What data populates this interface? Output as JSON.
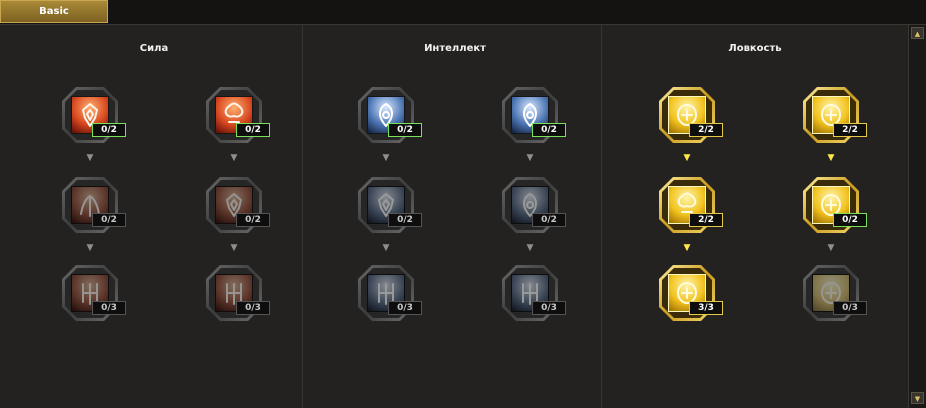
{
  "tabs": [
    {
      "label": "Basic",
      "selected": true
    }
  ],
  "columns": [
    {
      "title": "Сила",
      "theme": "fire",
      "rows": [
        [
          {
            "icon": "demon-crest-icon",
            "points": "0/2",
            "state": "available"
          },
          {
            "icon": "flame-knot-icon",
            "points": "0/2",
            "state": "available"
          }
        ],
        [
          {
            "icon": "claw-rune-icon",
            "points": "0/2",
            "state": "locked"
          },
          {
            "icon": "blade-crest-icon",
            "points": "0/2",
            "state": "locked"
          }
        ],
        [
          {
            "icon": "horn-glyph-icon",
            "points": "0/3",
            "state": "locked"
          },
          {
            "icon": "wing-glyph-icon",
            "points": "0/3",
            "state": "locked"
          }
        ]
      ]
    },
    {
      "title": "Интеллект",
      "theme": "arcane",
      "rows": [
        [
          {
            "icon": "ice-sigil-icon",
            "points": "0/2",
            "state": "available"
          },
          {
            "icon": "eye-sigil-icon",
            "points": "0/2",
            "state": "available"
          }
        ],
        [
          {
            "icon": "spiral-rune-icon",
            "points": "0/2",
            "state": "locked"
          },
          {
            "icon": "hood-sigil-icon",
            "points": "0/2",
            "state": "locked"
          }
        ],
        [
          {
            "icon": "trident-glyph-icon",
            "points": "0/3",
            "state": "locked"
          },
          {
            "icon": "tree-glyph-icon",
            "points": "0/3",
            "state": "locked"
          }
        ]
      ]
    },
    {
      "title": "Ловкость",
      "theme": "gold",
      "rows": [
        [
          {
            "icon": "beetle-emblem-icon",
            "points": "2/2",
            "state": "maxed"
          },
          {
            "icon": "scarab-emblem-icon",
            "points": "2/2",
            "state": "maxed"
          }
        ],
        [
          {
            "icon": "knot-emblem-icon",
            "points": "2/2",
            "state": "maxed"
          },
          {
            "icon": "spirit-emblem-icon",
            "points": "0/2",
            "state": "available"
          }
        ],
        [
          {
            "icon": "idol-emblem-icon",
            "points": "3/3",
            "state": "maxed"
          },
          {
            "icon": "totem-emblem-icon",
            "points": "0/3",
            "state": "locked"
          }
        ]
      ]
    }
  ],
  "arrows": [
    {
      "column": 0,
      "tree": 0,
      "after_row": 0,
      "active": false
    },
    {
      "column": 0,
      "tree": 1,
      "after_row": 0,
      "active": false
    },
    {
      "column": 0,
      "tree": 0,
      "after_row": 1,
      "active": false
    },
    {
      "column": 0,
      "tree": 1,
      "after_row": 1,
      "active": false
    },
    {
      "column": 1,
      "tree": 0,
      "after_row": 0,
      "active": false
    },
    {
      "column": 1,
      "tree": 1,
      "after_row": 0,
      "active": false
    },
    {
      "column": 1,
      "tree": 0,
      "after_row": 1,
      "active": false
    },
    {
      "column": 1,
      "tree": 1,
      "after_row": 1,
      "active": false
    },
    {
      "column": 2,
      "tree": 0,
      "after_row": 0,
      "active": true
    },
    {
      "column": 2,
      "tree": 1,
      "after_row": 0,
      "active": true
    },
    {
      "column": 2,
      "tree": 0,
      "after_row": 1,
      "active": true
    },
    {
      "column": 2,
      "tree": 1,
      "after_row": 1,
      "active": false
    }
  ],
  "arrow_glyph": "▼",
  "scrollbar": {
    "up_glyph": "▲",
    "down_glyph": "▼"
  },
  "themes": {
    "fire": {
      "top": "#ffb070",
      "mid": "#d84820",
      "bottom": "#5a0a06",
      "glyph": "#fff4ea"
    },
    "arcane": {
      "top": "#d8e8ff",
      "mid": "#4d76b4",
      "bottom": "#0f1e3a",
      "glyph": "#ffffff"
    },
    "gold": {
      "top": "#fff5a8",
      "mid": "#f2c21e",
      "bottom": "#9a6c00",
      "glyph": "#fffbe0"
    }
  },
  "colors": {
    "accent_gold": "#c9a650",
    "learned_border": "#7be05a",
    "maxed_border": "#e6c84a",
    "active_arrow": "#ffe64a"
  }
}
